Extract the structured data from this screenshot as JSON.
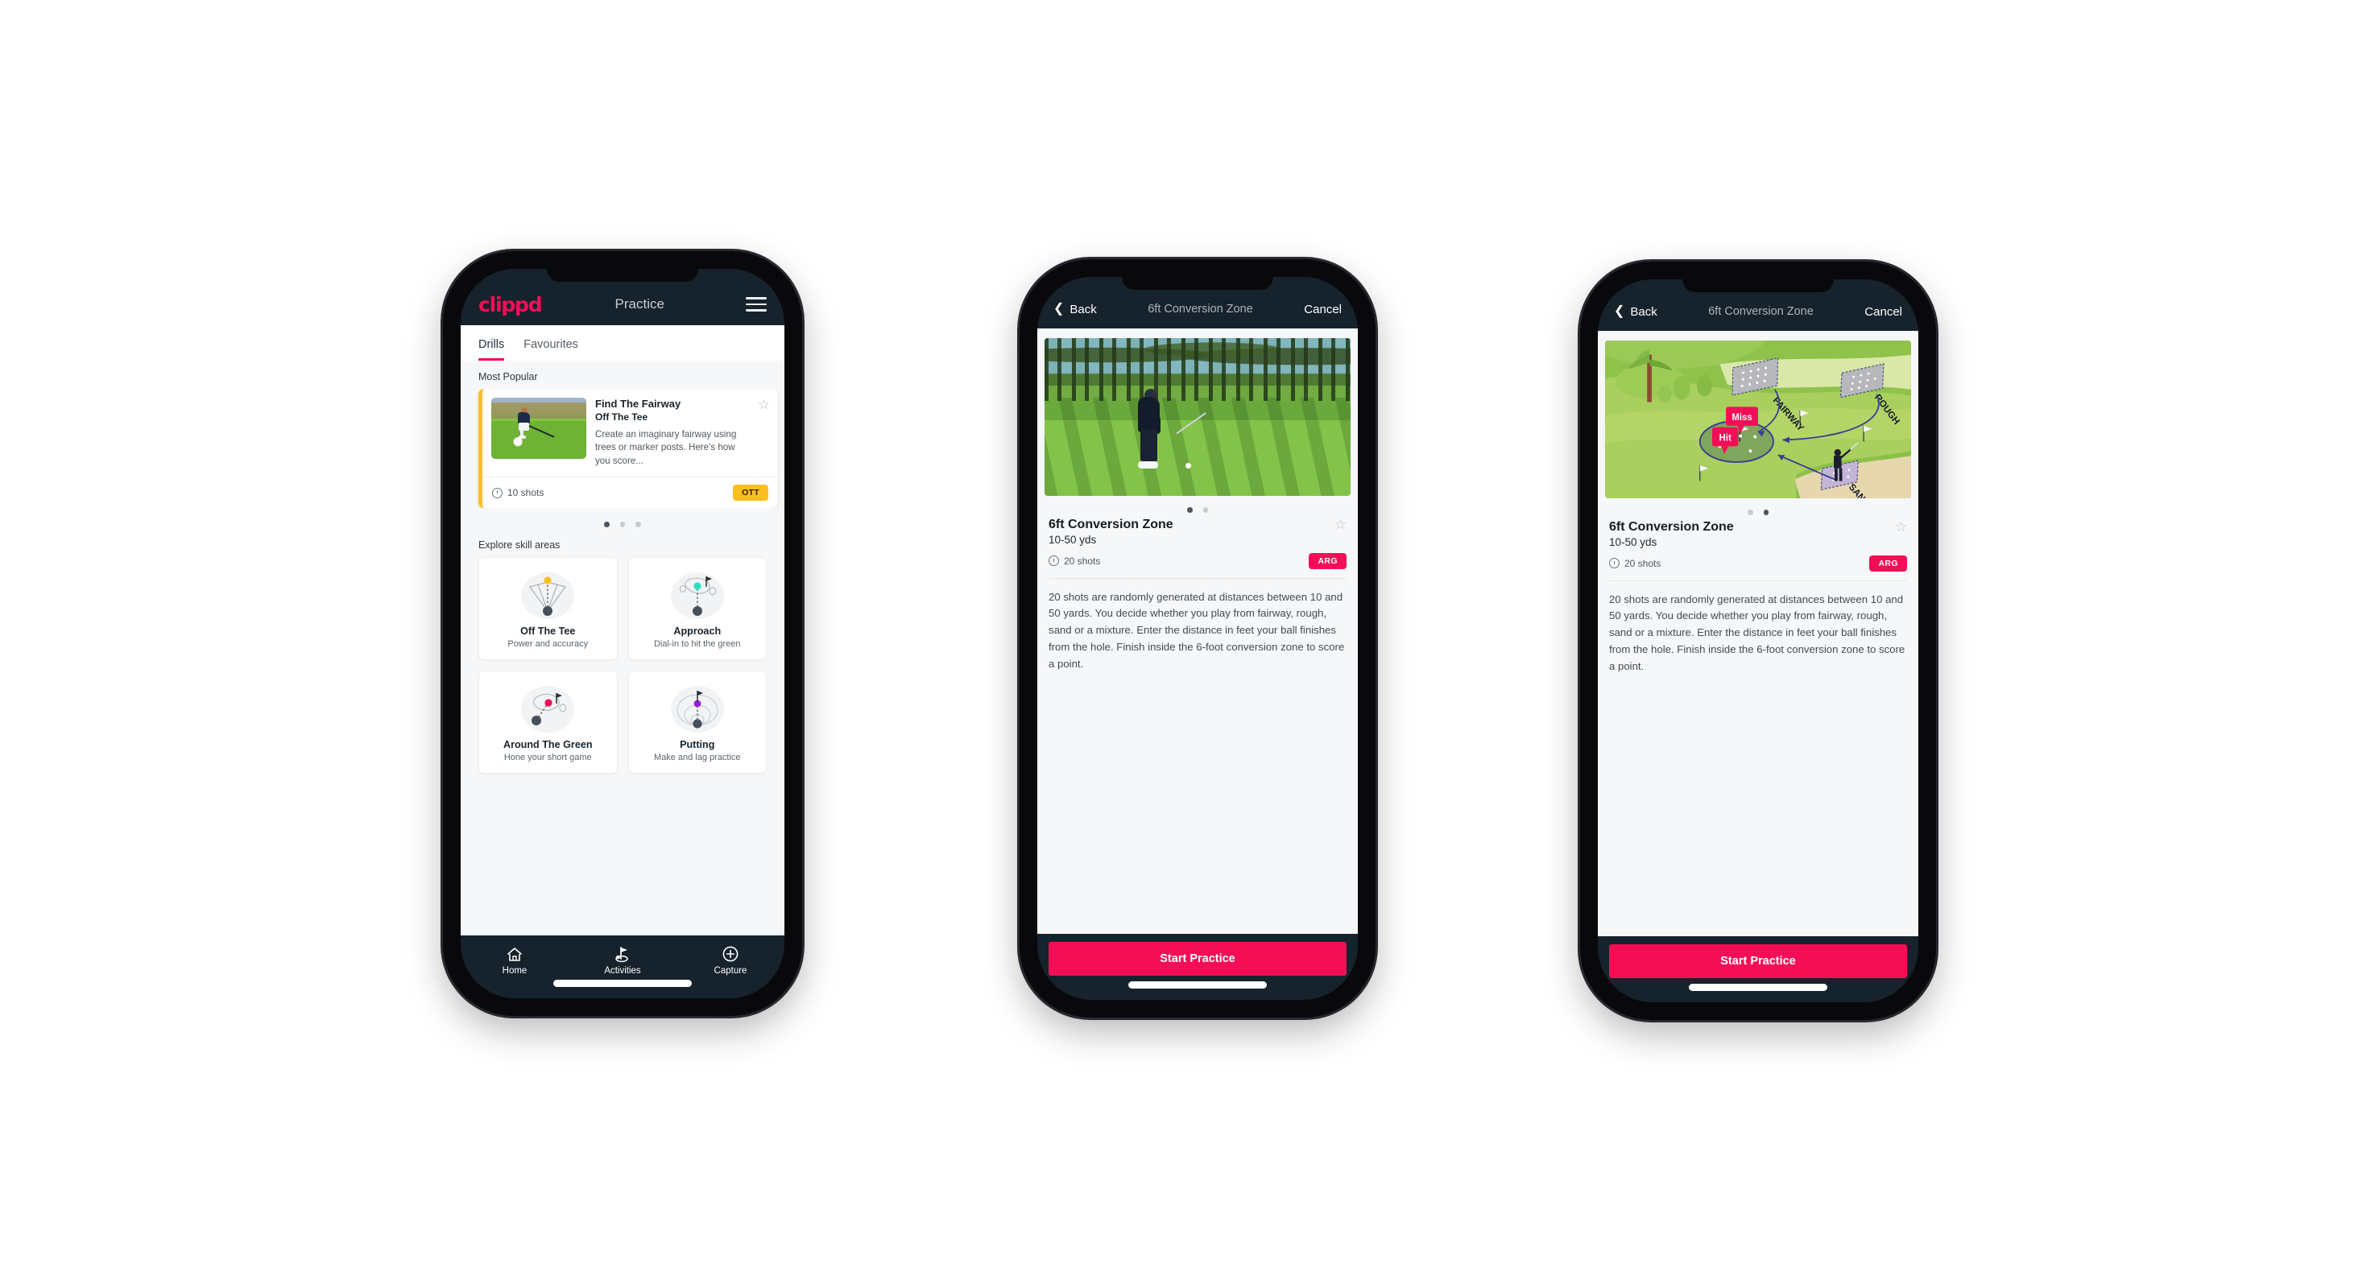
{
  "colors": {
    "brand_pink": "#f50e56",
    "header_dark": "#16222c",
    "badge_ott": "#fbbf24",
    "badge_arg": "#f50e56",
    "accent_teal": "#2ee0c0"
  },
  "phone1": {
    "header": {
      "brand": "clippd",
      "title": "Practice",
      "menu_icon": "hamburger-menu-icon"
    },
    "tabs": [
      {
        "label": "Drills",
        "active": true
      },
      {
        "label": "Favourites",
        "active": false
      }
    ],
    "most_popular": {
      "section_label": "Most Popular",
      "cards": [
        {
          "title": "Find The Fairway",
          "subtitle": "Off The Tee",
          "description": "Create an imaginary fairway using trees or marker posts. Here's how you score...",
          "shots": "10 shots",
          "badge": "OTT",
          "accent": "#fbbf24",
          "star_icon": "star-outline-icon"
        }
      ],
      "dots": {
        "count": 3,
        "active_index": 0
      }
    },
    "explore": {
      "section_label": "Explore skill areas",
      "cards": [
        {
          "title": "Off The Tee",
          "subtitle": "Power and accuracy",
          "icon": "tee-fan-icon",
          "dot_color": "#fbbf24"
        },
        {
          "title": "Approach",
          "subtitle": "Dial-in to hit the green",
          "icon": "approach-green-icon",
          "dot_color": "#2ee0c0"
        },
        {
          "title": "Around The Green",
          "subtitle": "Hone your short game",
          "icon": "around-green-icon",
          "dot_color": "#f50e56"
        },
        {
          "title": "Putting",
          "subtitle": "Make and lag practice",
          "icon": "putting-rings-icon",
          "dot_color": "#9b1fd6"
        }
      ]
    },
    "bottom_nav": [
      {
        "label": "Home",
        "icon": "home-icon",
        "active": false
      },
      {
        "label": "Activities",
        "icon": "golf-flag-icon",
        "active": true
      },
      {
        "label": "Capture",
        "icon": "plus-circle-icon",
        "active": false
      }
    ]
  },
  "phone2": {
    "header": {
      "back": "Back",
      "title": "6ft Conversion Zone",
      "cancel": "Cancel",
      "back_icon": "chevron-left-icon"
    },
    "media": {
      "type": "photo",
      "alt": "golfer-chipping-photo"
    },
    "dots": {
      "count": 2,
      "active_index": 0
    },
    "detail": {
      "name": "6ft Conversion Zone",
      "distance": "10-50 yds",
      "shots": "20 shots",
      "badge": "ARG",
      "star_icon": "star-outline-icon",
      "description": "20 shots are randomly generated at distances between 10 and 50 yards. You decide whether you play from fairway, rough, sand or a mixture. Enter the distance in feet your ball finishes from the hole. Finish inside the 6-foot conversion zone to score a point."
    },
    "cta": "Start Practice"
  },
  "phone3": {
    "header": {
      "back": "Back",
      "title": "6ft Conversion Zone",
      "cancel": "Cancel",
      "back_icon": "chevron-left-icon"
    },
    "media": {
      "type": "illustration",
      "alt": "golf-course-diagram",
      "labels": {
        "fairway": "FAIRWAY",
        "rough": "ROUGH",
        "sand": "SAND",
        "miss": "Miss",
        "hit": "Hit"
      }
    },
    "dots": {
      "count": 2,
      "active_index": 1
    },
    "detail": {
      "name": "6ft Conversion Zone",
      "distance": "10-50 yds",
      "shots": "20 shots",
      "badge": "ARG",
      "star_icon": "star-outline-icon",
      "description": "20 shots are randomly generated at distances between 10 and 50 yards. You decide whether you play from fairway, rough, sand or a mixture. Enter the distance in feet your ball finishes from the hole. Finish inside the 6-foot conversion zone to score a point."
    },
    "cta": "Start Practice"
  }
}
